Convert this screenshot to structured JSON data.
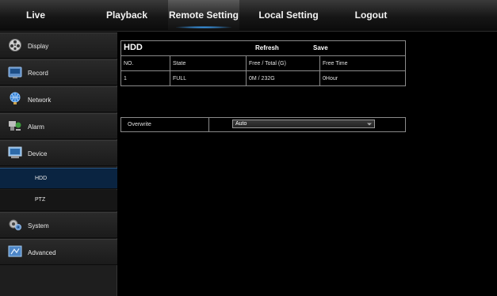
{
  "nav": {
    "live": "Live",
    "playback": "Playback",
    "remote_setting": "Remote Setting",
    "local_setting": "Local Setting",
    "logout": "Logout",
    "active": "remote_setting"
  },
  "sidebar": {
    "items": [
      {
        "label": "Display",
        "icon": "display-icon"
      },
      {
        "label": "Record",
        "icon": "record-icon"
      },
      {
        "label": "Network",
        "icon": "network-icon"
      },
      {
        "label": "Alarm",
        "icon": "alarm-icon"
      },
      {
        "label": "Device",
        "icon": "device-icon"
      },
      {
        "label": "System",
        "icon": "system-icon"
      },
      {
        "label": "Advanced",
        "icon": "advanced-icon"
      }
    ],
    "sub_items": [
      {
        "label": "HDD",
        "selected": true
      },
      {
        "label": "PTZ",
        "selected": false
      }
    ]
  },
  "hdd": {
    "title": "HDD",
    "refresh_label": "Refresh",
    "save_label": "Save",
    "columns": [
      "NO.",
      "State",
      "Free / Total (G)",
      "Free Time"
    ],
    "rows": [
      [
        "1",
        "FULL",
        "0M / 232G",
        "0Hour"
      ]
    ]
  },
  "overwrite": {
    "label": "Overwrite",
    "value": "Auto"
  },
  "colors": {
    "accent": "#3fa6ff",
    "selected_bg": "#0a2441",
    "border": "#8a8a8a"
  }
}
